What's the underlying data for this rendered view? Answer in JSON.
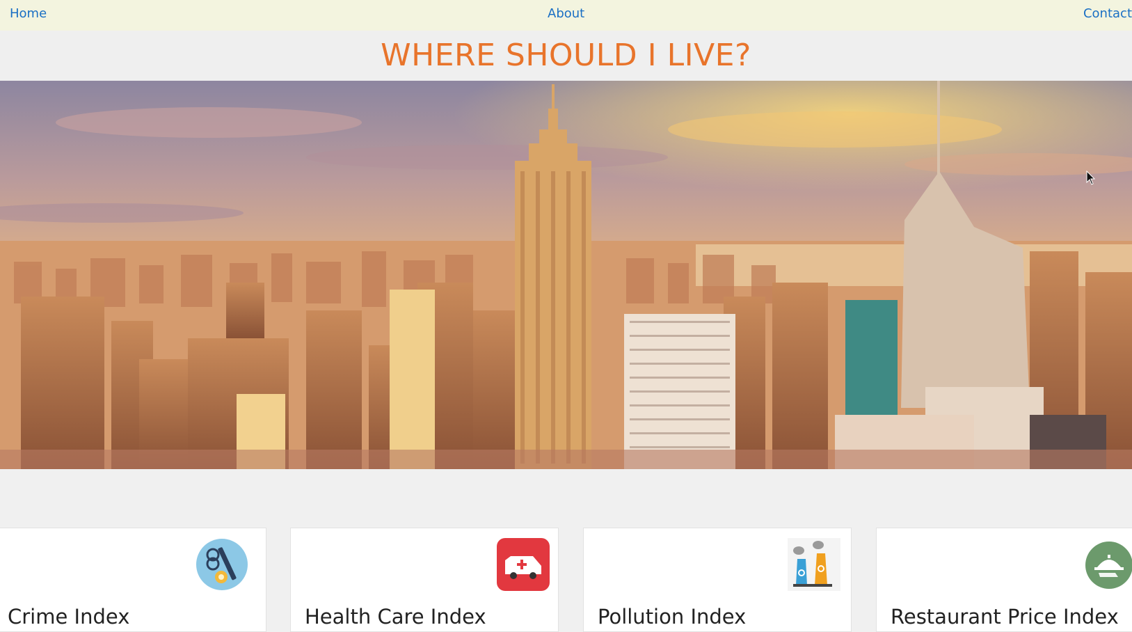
{
  "nav": {
    "home": "Home",
    "about": "About",
    "contact": "Contact"
  },
  "page": {
    "title": "WHERE SHOULD I LIVE?"
  },
  "cards": [
    {
      "title": "Crime Index",
      "icon": "crime-handcuffs-icon"
    },
    {
      "title": "Health Care Index",
      "icon": "ambulance-icon"
    },
    {
      "title": "Pollution Index",
      "icon": "factory-pollution-icon"
    },
    {
      "title": "Restaurant Price Index",
      "icon": "food-cloche-icon"
    }
  ],
  "colors": {
    "accent": "#e8742b",
    "link": "#1a6fc4",
    "nav_bg": "#f3f4df",
    "page_bg": "#f0f0f0"
  }
}
